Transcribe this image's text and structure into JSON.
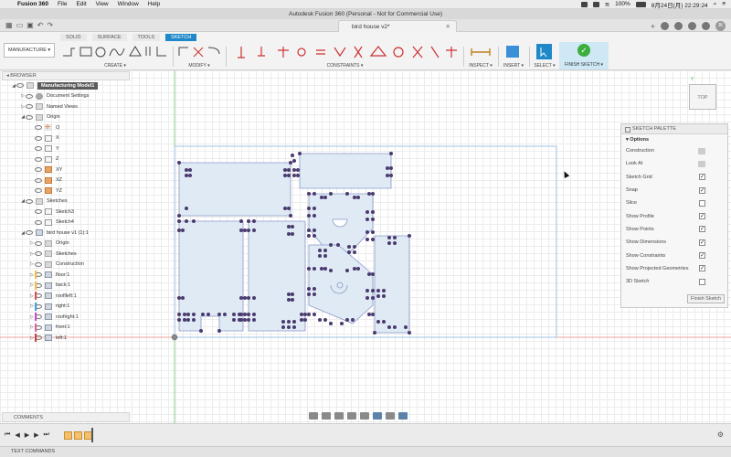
{
  "macbar": {
    "app": "Fusion 360",
    "menus": [
      "File",
      "Edit",
      "View",
      "Window",
      "Help"
    ],
    "battery": "100%",
    "datetime": "8月24日(月) 22:29:24"
  },
  "window": {
    "title": "Autodesk Fusion 360 (Personal - Not for Commercial Use)"
  },
  "doc_tab": {
    "name": "bird house v2*"
  },
  "user_initials": "JK",
  "ribbon": {
    "workspace": "MANUFACTURE",
    "tabs": [
      "SOLID",
      "SURFACE",
      "TOOLS",
      "SKETCH"
    ],
    "active_tab": "SKETCH",
    "groups": {
      "create": "CREATE ▾",
      "modify": "MODIFY ▾",
      "constraints": "CONSTRAINTS ▾",
      "inspect": "INSPECT ▾",
      "insert": "INSERT ▾",
      "select": "SELECT ▾",
      "finish": "FINISH SKETCH ▾"
    }
  },
  "browser": {
    "header": "BROWSER",
    "rows": [
      {
        "indent": 0,
        "arrow": "◢",
        "icon": "folder",
        "label": "Manufacturing Model1",
        "top": true
      },
      {
        "indent": 1,
        "arrow": "▷",
        "icon": "gear",
        "label": "Document Settings"
      },
      {
        "indent": 1,
        "arrow": "▷",
        "icon": "folder",
        "label": "Named Views"
      },
      {
        "indent": 1,
        "arrow": "◢",
        "icon": "folder",
        "label": "Origin"
      },
      {
        "indent": 2,
        "arrow": "",
        "icon": "origin",
        "label": "O"
      },
      {
        "indent": 2,
        "arrow": "",
        "icon": "sketch",
        "label": "X"
      },
      {
        "indent": 2,
        "arrow": "",
        "icon": "sketch",
        "label": "Y"
      },
      {
        "indent": 2,
        "arrow": "",
        "icon": "sketch",
        "label": "Z"
      },
      {
        "indent": 2,
        "arrow": "",
        "icon": "plane",
        "label": "XY"
      },
      {
        "indent": 2,
        "arrow": "",
        "icon": "plane",
        "label": "XZ"
      },
      {
        "indent": 2,
        "arrow": "",
        "icon": "plane",
        "label": "YZ"
      },
      {
        "indent": 1,
        "arrow": "◢",
        "icon": "folder",
        "label": "Sketches"
      },
      {
        "indent": 2,
        "arrow": "",
        "icon": "sketch",
        "label": "Sketch3"
      },
      {
        "indent": 2,
        "arrow": "",
        "icon": "sketch",
        "label": "Sketch4"
      },
      {
        "indent": 1,
        "arrow": "◢",
        "icon": "body",
        "label": "bird house v1 (1):1"
      },
      {
        "indent": 2,
        "arrow": "▷",
        "icon": "folder",
        "label": "Origin"
      },
      {
        "indent": 2,
        "arrow": "▷",
        "icon": "folder",
        "label": "Sketches"
      },
      {
        "indent": 2,
        "arrow": "▷",
        "icon": "folder",
        "label": "Construction"
      },
      {
        "indent": 2,
        "arrow": "▷",
        "icon": "body",
        "label": "floor:1",
        "color": "#f0c040"
      },
      {
        "indent": 2,
        "arrow": "▷",
        "icon": "body",
        "label": "back:1",
        "color": "#f0c040"
      },
      {
        "indent": 2,
        "arrow": "▷",
        "icon": "body",
        "label": "rooflleft:1",
        "color": "#e05050"
      },
      {
        "indent": 2,
        "arrow": "▷",
        "icon": "body",
        "label": "right:1",
        "color": "#40a0e0"
      },
      {
        "indent": 2,
        "arrow": "▷",
        "icon": "body",
        "label": "roofright:1",
        "color": "#c050c0"
      },
      {
        "indent": 2,
        "arrow": "▷",
        "icon": "body",
        "label": "front:1",
        "color": "#e060a0"
      },
      {
        "indent": 2,
        "arrow": "▷",
        "icon": "body",
        "label": "left:1",
        "color": "#d04040"
      }
    ]
  },
  "viewcube": {
    "face": "TOP",
    "axis_label": "Y"
  },
  "palette": {
    "header": "SKETCH PALETTE",
    "section": "Options",
    "options": [
      {
        "label": "Construction",
        "kind": "icon"
      },
      {
        "label": "Look At",
        "kind": "icon"
      },
      {
        "label": "Sketch Grid",
        "kind": "check",
        "checked": true
      },
      {
        "label": "Snap",
        "kind": "check",
        "checked": true
      },
      {
        "label": "Slice",
        "kind": "check",
        "checked": false
      },
      {
        "label": "Show Profile",
        "kind": "check",
        "checked": true
      },
      {
        "label": "Show Points",
        "kind": "check",
        "checked": true
      },
      {
        "label": "Show Dimensions",
        "kind": "check",
        "checked": true
      },
      {
        "label": "Show Constraints",
        "kind": "check",
        "checked": true
      },
      {
        "label": "Show Projected Geometries",
        "kind": "check",
        "checked": true
      },
      {
        "label": "3D Sketch",
        "kind": "check",
        "checked": false
      }
    ],
    "finish_button": "Finish Sketch"
  },
  "bottom": {
    "comments": "COMMENTS",
    "text_commands": "TEXT COMMANDS"
  },
  "colors": {
    "accent": "#1e88c8",
    "sketch_fill": "#dfeaf5",
    "sketch_line": "#8b9ac7",
    "point": "#4a3a6e",
    "finish_green": "#3cae3c"
  }
}
